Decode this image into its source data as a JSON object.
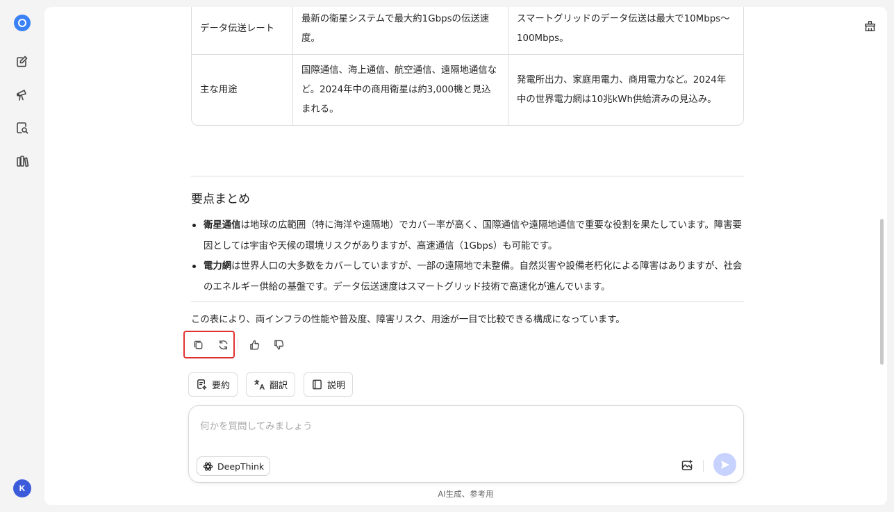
{
  "sidebar": {
    "logo": "deepseek-logo",
    "items": [
      {
        "icon": "new-chat-icon"
      },
      {
        "icon": "discover-icon"
      },
      {
        "icon": "search-docs-icon"
      },
      {
        "icon": "library-icon"
      }
    ],
    "avatar_letter": "K"
  },
  "table": {
    "rows": [
      {
        "label": "データ伝送レート",
        "satellite": "最新の衛星システムで最大約1Gbpsの伝送速度。",
        "grid": "スマートグリッドのデータ伝送は最大で10Mbps～100Mbps。"
      },
      {
        "label": "主な用途",
        "satellite": "国際通信、海上通信、航空通信、遠隔地通信など。2024年中の商用衛星は約3,000機と見込まれる。",
        "grid": "発電所出力、家庭用電力、商用電力など。2024年中の世界電力網は10兆kWh供給済みの見込み。"
      }
    ]
  },
  "summary_section": {
    "heading": "要点まとめ",
    "points": [
      {
        "bold": "衛星通信",
        "text": "は地球の広範囲（特に海洋や遠隔地）でカバー率が高く、国際通信や遠隔地通信で重要な役割を果たしています。障害要因としては宇宙や天候の環境リスクがありますが、高速通信（1Gbps）も可能です。"
      },
      {
        "bold": "電力網",
        "text": "は世界人口の大多数をカバーしていますが、一部の遠隔地で未整備。自然災害や設備老朽化による障害はありますが、社会のエネルギー供給の基盤です。データ伝送速度はスマートグリッド技術で高速化が進んでいます。"
      }
    ],
    "conclusion": "この表により、両インフラの性能や普及度、障害リスク、用途が一目で比較できる構成になっています。"
  },
  "quick_actions": {
    "summarize": "要約",
    "translate": "翻訳",
    "explain": "説明"
  },
  "composer": {
    "placeholder": "何かを質問してみましょう",
    "deepthink_label": "DeepThink"
  },
  "footer_note": "AI生成、参考用"
}
